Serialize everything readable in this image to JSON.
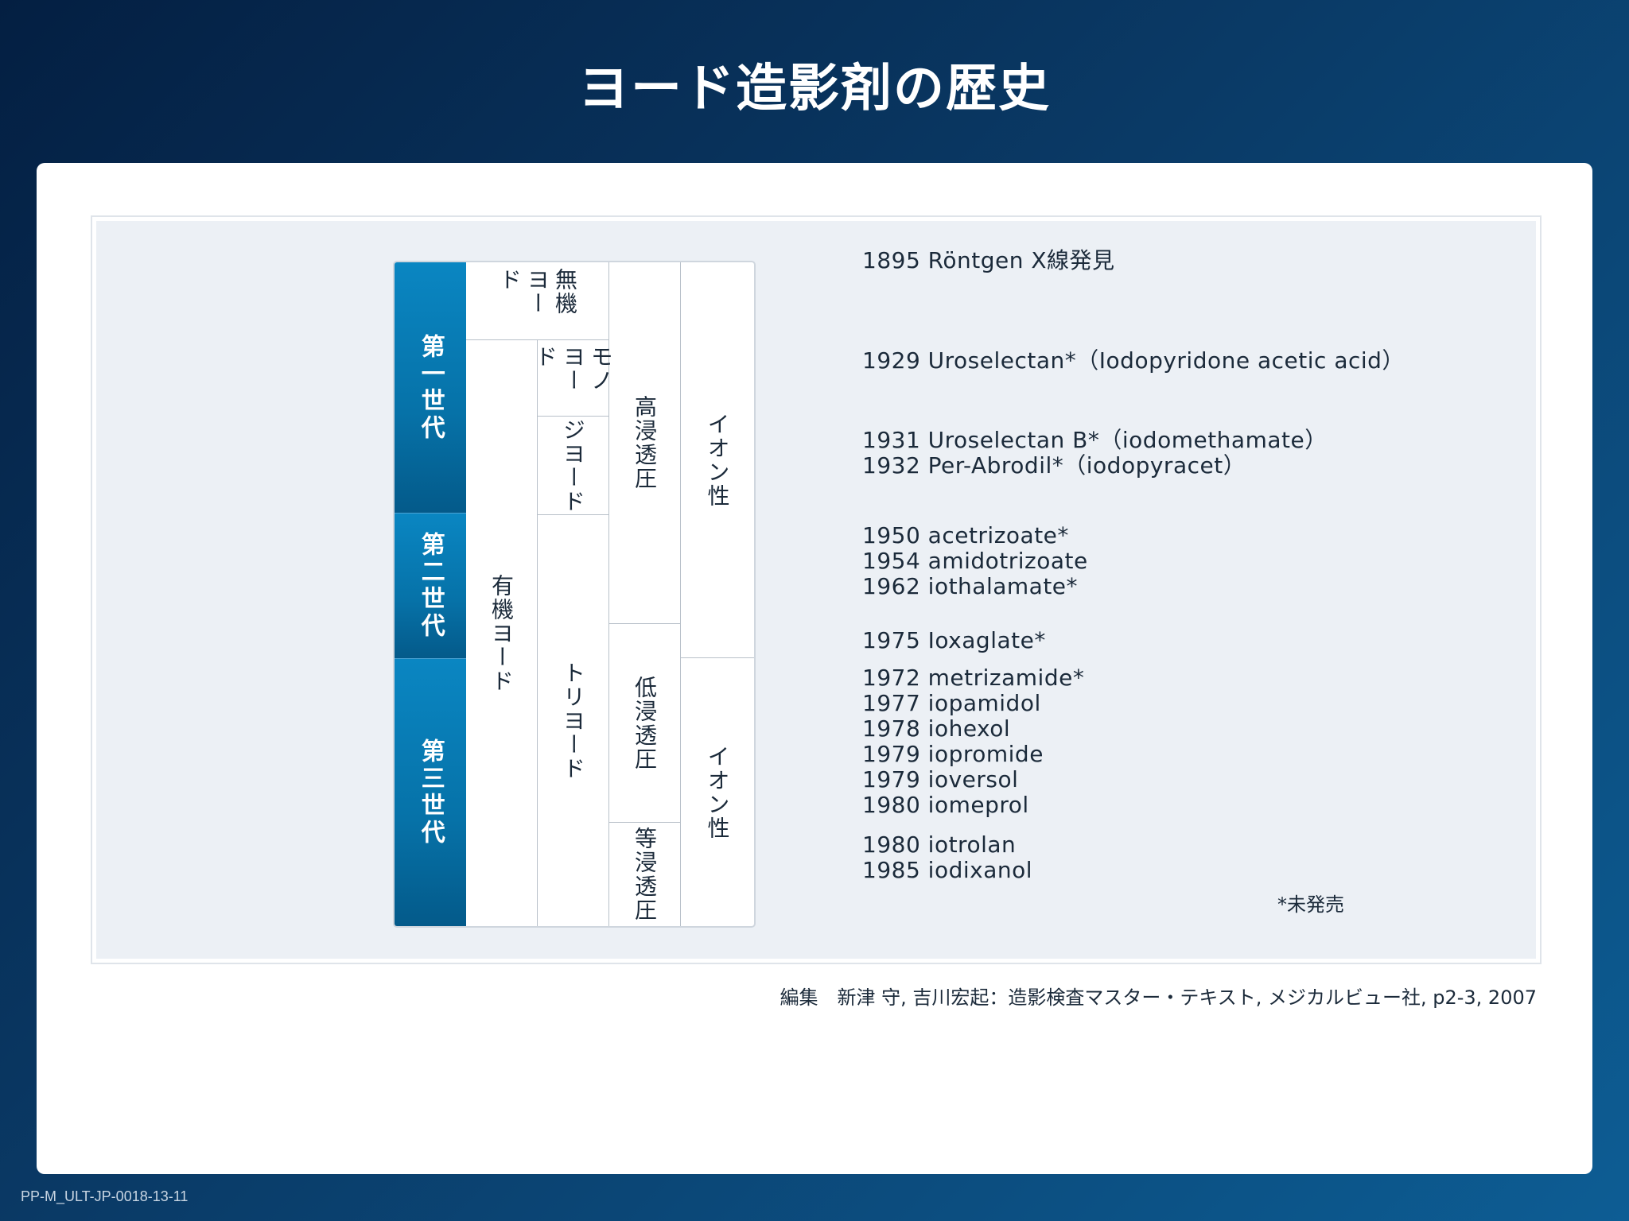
{
  "title": "ヨード造影剤の歴史",
  "generations": [
    "第一世代",
    "第二世代",
    "第三世代"
  ],
  "iodine_type": {
    "inorganic": "無機ヨード",
    "organic": "有機ヨード"
  },
  "iodine_count": {
    "mono": "モノヨード",
    "di": "ジヨード",
    "tri": "トリヨード"
  },
  "osmolality": {
    "high": "高浸透圧",
    "low": "低浸透圧",
    "iso": "等浸透圧"
  },
  "ionicity": {
    "ionic": "イオン性",
    "nonionic": "イオン性"
  },
  "timeline": [
    "1895 Röntgen X線発見",
    "1929 Uroselectan*（Iodopyridone acetic acid）",
    "1931 Uroselectan B*（iodomethamate）",
    "1932 Per-Abrodil*（iodopyracet）",
    "1950 acetrizoate*",
    "1954 amidotrizoate",
    "1962 iothalamate*",
    "1975 Ioxaglate*",
    "1972 metrizamide*",
    "1977 iopamidol",
    "1978 iohexol",
    "1979 iopromide",
    "1979 ioversol",
    "1980 iomeprol",
    "1980 iotrolan",
    "1985 iodixanol"
  ],
  "note": "*未発売",
  "source": "編集　新津 守, 吉川宏起：造影検査マスター・テキスト, メジカルビュー社, p2-3, 2007",
  "code": "PP-M_ULT-JP-0018-13-11",
  "colors": {
    "generation_band": "#0672a8",
    "background_dark": "#041f42"
  }
}
